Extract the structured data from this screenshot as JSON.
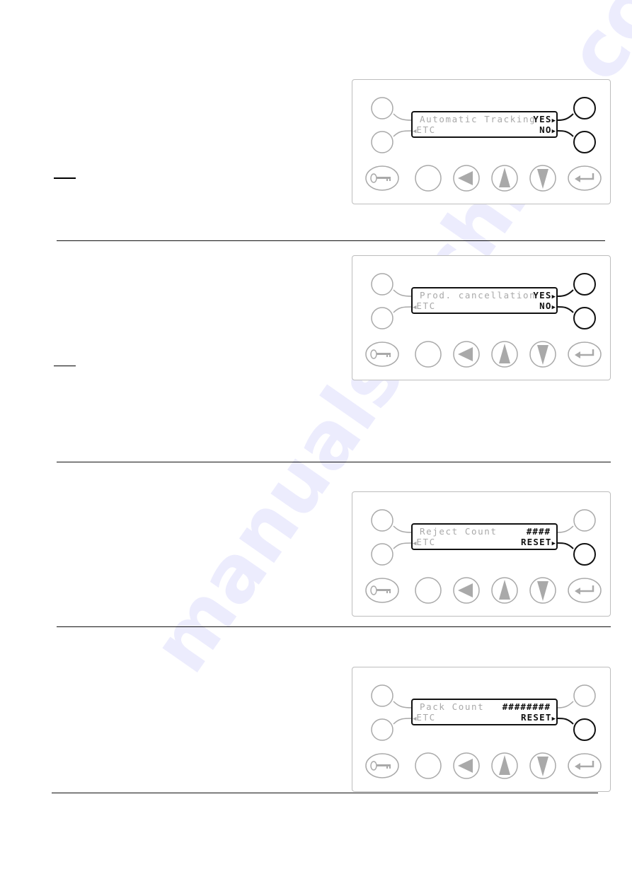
{
  "watermark": "manualsarchive.com",
  "panels": [
    {
      "lcd_title": "Automatic Tracking",
      "lcd_value": "",
      "etc_label": "ETC",
      "right_top_label": "YES",
      "right_bottom_label": "NO",
      "active_softkeys": [
        "right-top",
        "right-bottom"
      ]
    },
    {
      "lcd_title": "Prod. cancellation",
      "lcd_value": "",
      "etc_label": "ETC",
      "right_top_label": "YES",
      "right_bottom_label": "NO",
      "active_softkeys": [
        "right-top",
        "right-bottom"
      ]
    },
    {
      "lcd_title": "Reject Count",
      "lcd_value": "####",
      "etc_label": "ETC",
      "right_top_label": "",
      "right_bottom_label": "RESET",
      "active_softkeys": [
        "right-bottom"
      ]
    },
    {
      "lcd_title": "Pack Count",
      "lcd_value": "########",
      "etc_label": "ETC",
      "right_top_label": "",
      "right_bottom_label": "RESET",
      "active_softkeys": [
        "right-bottom"
      ]
    }
  ],
  "keypad": {
    "keys": [
      "key-icon",
      "blank-key",
      "left-arrow-icon",
      "up-arrow-icon",
      "down-arrow-icon",
      "enter-icon"
    ]
  },
  "colors": {
    "inactive": "#a9a9a9",
    "active": "#111111",
    "panel_border": "#bdbdbd"
  }
}
